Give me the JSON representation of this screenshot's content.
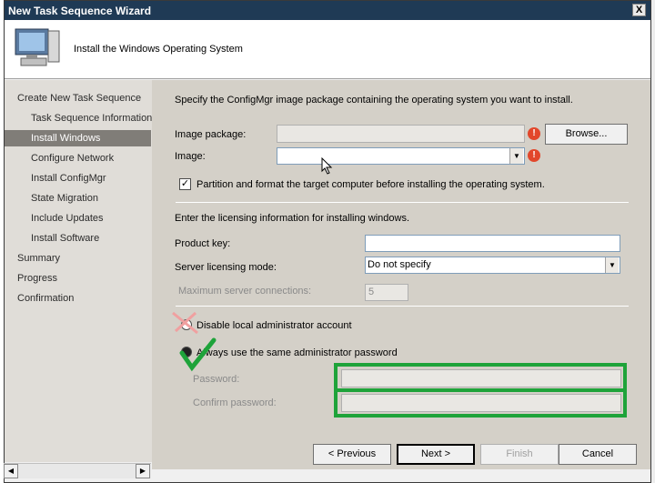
{
  "window": {
    "title": "New Task Sequence Wizard",
    "close_label": "X"
  },
  "banner": {
    "heading": "Install the Windows Operating System"
  },
  "nav": {
    "items": [
      {
        "label": "Create New Task Sequence",
        "indent": 0,
        "active": false
      },
      {
        "label": "Task Sequence Information",
        "indent": 1,
        "active": false
      },
      {
        "label": "Install Windows",
        "indent": 1,
        "active": true
      },
      {
        "label": "Configure Network",
        "indent": 1,
        "active": false
      },
      {
        "label": "Install ConfigMgr",
        "indent": 1,
        "active": false
      },
      {
        "label": "State Migration",
        "indent": 1,
        "active": false
      },
      {
        "label": "Include Updates",
        "indent": 1,
        "active": false
      },
      {
        "label": "Install Software",
        "indent": 1,
        "active": false
      },
      {
        "label": "Summary",
        "indent": 0,
        "active": false
      },
      {
        "label": "Progress",
        "indent": 0,
        "active": false
      },
      {
        "label": "Confirmation",
        "indent": 0,
        "active": false
      }
    ]
  },
  "main": {
    "intro": "Specify the ConfigMgr image package containing the operating system you want to install.",
    "image_package_label": "Image package:",
    "image_package_value": "",
    "browse_label": "Browse...",
    "image_label": "Image:",
    "image_value": "",
    "error_glyph": "!",
    "partition_label": "Partition and format the target computer before installing the operating system.",
    "partition_checked": "✓",
    "licensing_intro": "Enter the licensing information for installing windows.",
    "product_key_label": "Product key:",
    "product_key_value": "",
    "server_mode_label": "Server licensing mode:",
    "server_mode_value": "Do not specify",
    "max_conn_label": "Maximum server connections:",
    "max_conn_value": "5",
    "disable_admin_label": "Disable local administrator account",
    "same_password_label": "Always use the same administrator password",
    "password_label": "Password:",
    "confirm_password_label": "Confirm password:"
  },
  "footer": {
    "previous_label": "< Previous",
    "next_label": "Next >",
    "finish_label": "Finish",
    "cancel_label": "Cancel"
  },
  "colors": {
    "titlebar": "#1f3a55",
    "highlight": "#1ea33a",
    "error": "#e2472b",
    "nav_active": "#807d78"
  }
}
